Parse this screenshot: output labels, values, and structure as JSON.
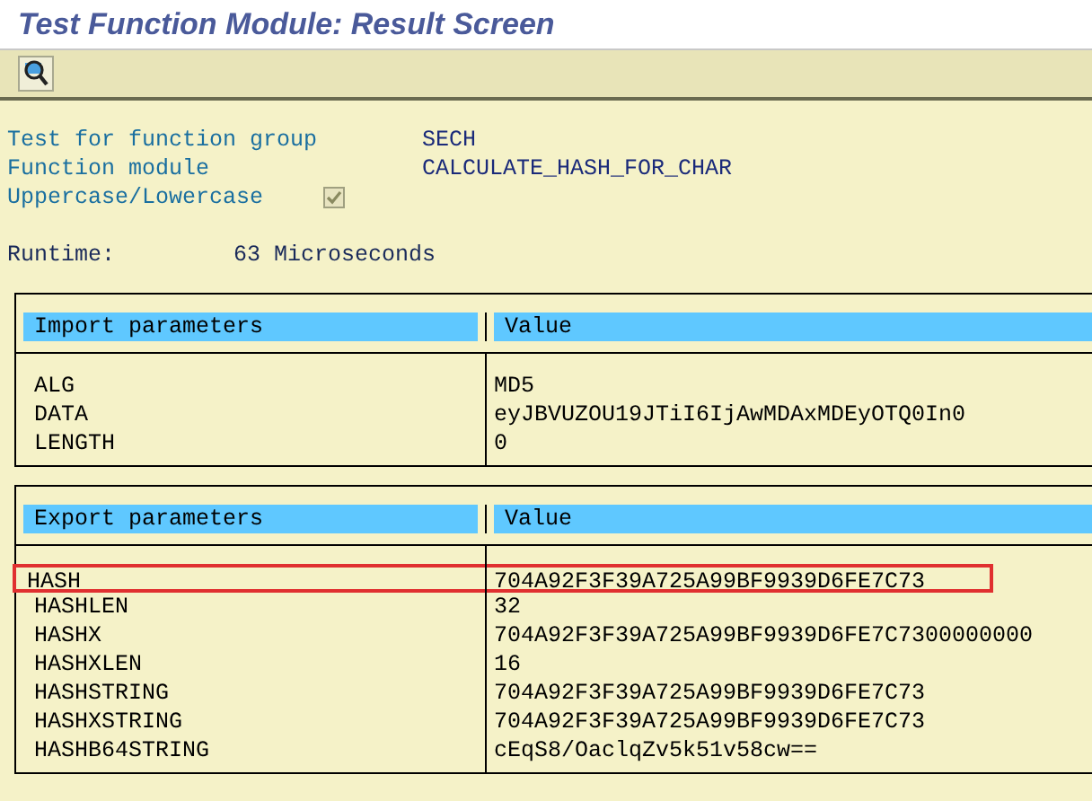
{
  "window": {
    "title": "Test Function Module: Result Screen"
  },
  "toolbar": {
    "buttons": [
      {
        "kind": "display"
      }
    ]
  },
  "header": {
    "fields": [
      {
        "label": "Test for function group",
        "value": "SECH"
      },
      {
        "label": "Function module",
        "value": "CALCULATE_HASH_FOR_CHAR"
      }
    ],
    "case_option": {
      "label": "Uppercase/Lowercase",
      "checked": true,
      "disabled": true
    },
    "runtime": {
      "label": "Runtime:",
      "value": "63 Microseconds"
    }
  },
  "tables": [
    {
      "columns": [
        "Import parameters",
        "Value"
      ],
      "rows": [
        {
          "name": "ALG",
          "value": "MD5",
          "highlighted": false
        },
        {
          "name": "DATA",
          "value": "eyJBVUZOU19JTiI6IjAwMDAxMDEyOTQ0In0",
          "highlighted": false
        },
        {
          "name": "LENGTH",
          "value": "0",
          "highlighted": false
        }
      ]
    },
    {
      "columns": [
        "Export parameters",
        "Value"
      ],
      "rows": [
        {
          "name": "HASH",
          "value": "704A92F3F39A725A99BF9939D6FE7C73",
          "highlighted": true
        },
        {
          "name": "HASHLEN",
          "value": "32",
          "highlighted": false
        },
        {
          "name": "HASHX",
          "value": "704A92F3F39A725A99BF9939D6FE7C7300000000",
          "highlighted": false
        },
        {
          "name": "HASHXLEN",
          "value": "16",
          "highlighted": false
        },
        {
          "name": "HASHSTRING",
          "value": "704A92F3F39A725A99BF9939D6FE7C73",
          "highlighted": false
        },
        {
          "name": "HASHXSTRING",
          "value": "704A92F3F39A725A99BF9939D6FE7C73",
          "highlighted": false
        },
        {
          "name": "HASHB64STRING",
          "value": "cEqS8/OaclqZv5k51v58cw==",
          "highlighted": false
        }
      ]
    }
  ]
}
